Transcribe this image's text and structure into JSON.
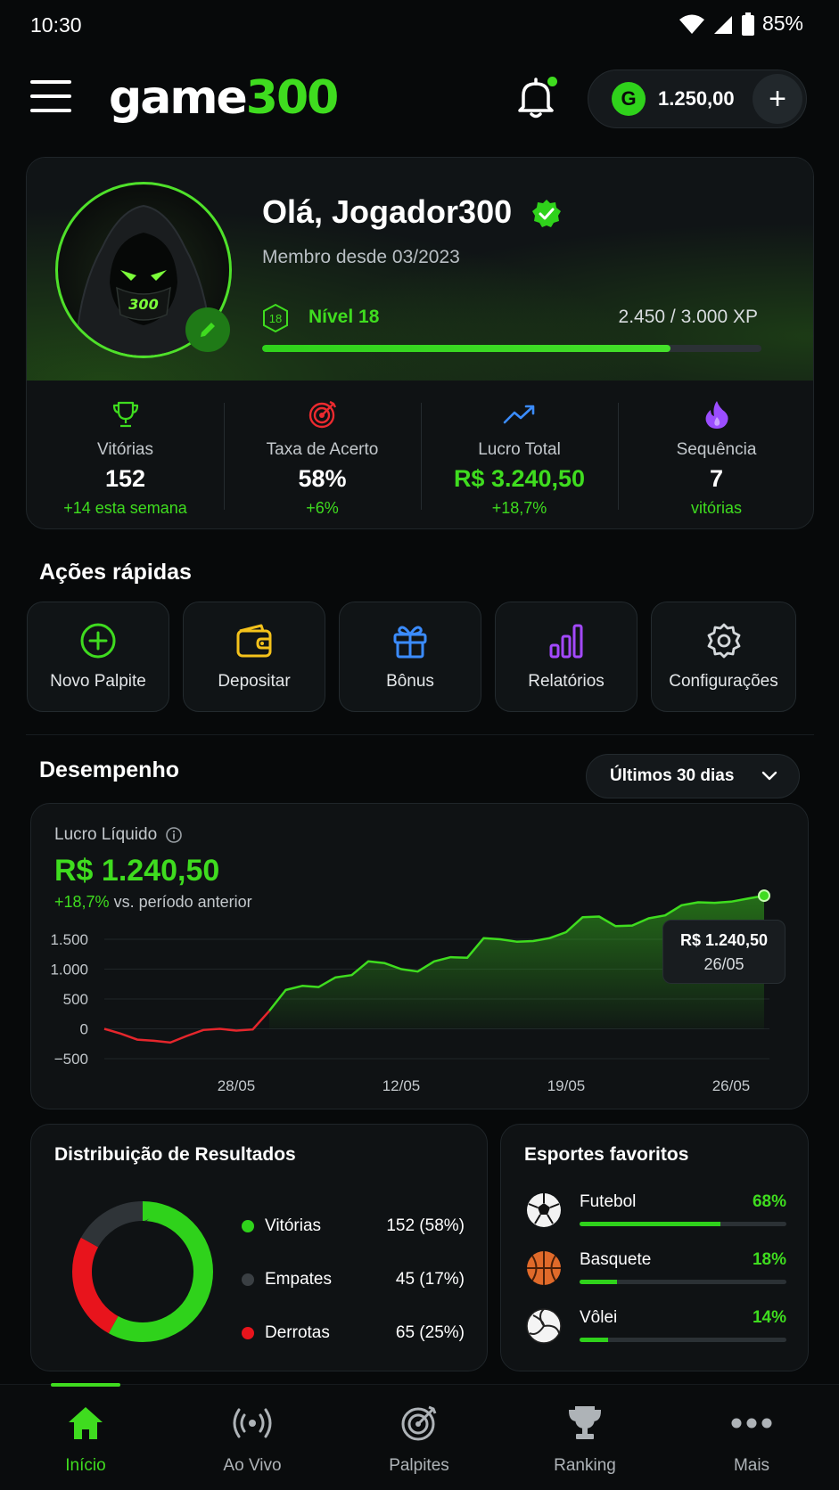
{
  "status_bar": {
    "time": "10:30",
    "battery": "85%"
  },
  "header": {
    "logo_prefix": "game",
    "logo_suffix": "300",
    "balance": "1.250,00",
    "coin_letter": "G"
  },
  "profile": {
    "greeting": "Olá, Jogador300",
    "member_since": "Membro desde 03/2023",
    "level_number": "18",
    "level_label": "Nível 18",
    "xp_text": "2.450 / 3.000 XP",
    "xp_fraction": 0.817,
    "avatar_tag": "300"
  },
  "stats": [
    {
      "label": "Vitórias",
      "value": "152",
      "sub": "+14 esta semana"
    },
    {
      "label": "Taxa de Acerto",
      "value": "58%",
      "sub": "+6%"
    },
    {
      "label": "Lucro Total",
      "value": "R$ 3.240,50",
      "sub": "+18,7%"
    },
    {
      "label": "Sequência",
      "value": "7",
      "sub": "vitórias"
    }
  ],
  "quick_actions": {
    "title": "Ações rápidas",
    "items": [
      {
        "label": "Novo Palpite",
        "icon": "plus-circle-icon"
      },
      {
        "label": "Depositar",
        "icon": "wallet-icon"
      },
      {
        "label": "Bônus",
        "icon": "gift-icon"
      },
      {
        "label": "Relatórios",
        "icon": "bar-chart-icon"
      },
      {
        "label": "Configurações",
        "icon": "gear-icon"
      }
    ]
  },
  "performance": {
    "title": "Desempenho",
    "period": "Últimos 30 dias",
    "chart_label": "Lucro Líquido",
    "value": "R$ 1.240,50",
    "change": "+18,7%",
    "change_suffix": " vs. período anterior",
    "tooltip_value": "R$ 1.240,50",
    "tooltip_date": "26/05"
  },
  "chart_data": {
    "type": "area",
    "title": "Lucro Líquido",
    "ylim": [
      -500,
      1500
    ],
    "y_ticks": [
      "1.500",
      "1.000",
      "500",
      "0",
      "−500"
    ],
    "y_tick_values": [
      1500,
      1000,
      500,
      0,
      -500
    ],
    "x_tick_labels": [
      "28/05",
      "12/05",
      "19/05",
      "26/05"
    ],
    "x_tick_index": [
      8,
      18,
      28,
      38
    ],
    "values": [
      0,
      -80,
      -180,
      -200,
      -230,
      -120,
      -20,
      0,
      -30,
      -10,
      300,
      650,
      720,
      700,
      860,
      900,
      1130,
      1100,
      1000,
      960,
      1130,
      1200,
      1190,
      1520,
      1500,
      1460,
      1470,
      1520,
      1620,
      1870,
      1880,
      1720,
      1730,
      1850,
      1900,
      2070,
      2120,
      2110,
      2130,
      2180,
      2230
    ],
    "grid": true,
    "colors": {
      "positive": "#3fdc1f",
      "negative": "#e5262c"
    }
  },
  "distribution": {
    "title": "Distribuição de Resultados",
    "items": [
      {
        "name": "Vitórias",
        "value": "152 (58%)",
        "color": "#2fd21b",
        "pct": 58
      },
      {
        "name": "Empates",
        "value": "45 (17%)",
        "color": "#2f3438",
        "pct": 17
      },
      {
        "name": "Derrotas",
        "value": "65 (25%)",
        "color": "#e8141c",
        "pct": 25
      }
    ]
  },
  "sports": {
    "title": "Esportes favoritos",
    "items": [
      {
        "name": "Futebol",
        "pct": "68%",
        "fraction": 0.68
      },
      {
        "name": "Basquete",
        "pct": "18%",
        "fraction": 0.18
      },
      {
        "name": "Vôlei",
        "pct": "14%",
        "fraction": 0.14
      }
    ]
  },
  "nav": {
    "items": [
      {
        "label": "Início"
      },
      {
        "label": "Ao Vivo"
      },
      {
        "label": "Palpites"
      },
      {
        "label": "Ranking"
      },
      {
        "label": "Mais"
      }
    ]
  }
}
